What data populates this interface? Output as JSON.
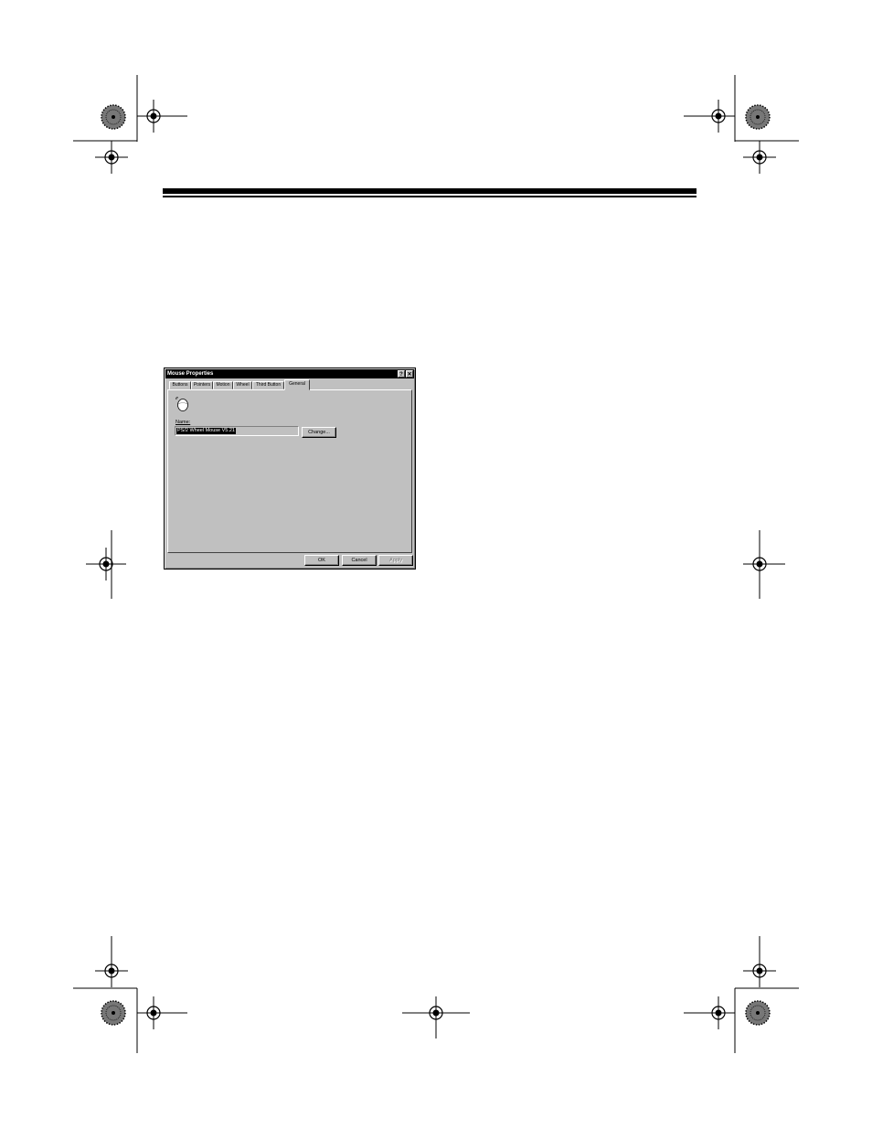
{
  "dialog": {
    "title": "Mouse Properties",
    "help_button": "?",
    "close_button": "✕",
    "tabs": [
      {
        "label": "Buttons",
        "active": false
      },
      {
        "label": "Pointers",
        "active": false
      },
      {
        "label": "Motion",
        "active": false
      },
      {
        "label": "Wheel",
        "active": false
      },
      {
        "label": "Third Button",
        "active": false
      },
      {
        "label": "General",
        "active": true
      }
    ],
    "general": {
      "icon": "mouse-icon",
      "name_label": "Name:",
      "name_value": "PS/2 Wheel Mouse V5.21",
      "change_button": "Change..."
    },
    "footer": {
      "ok": "OK",
      "cancel": "Cancel",
      "apply": "Apply"
    }
  },
  "colors": {
    "dialog_face": "#c0c0c0",
    "titlebar": "#000000",
    "selection": "#000000"
  }
}
